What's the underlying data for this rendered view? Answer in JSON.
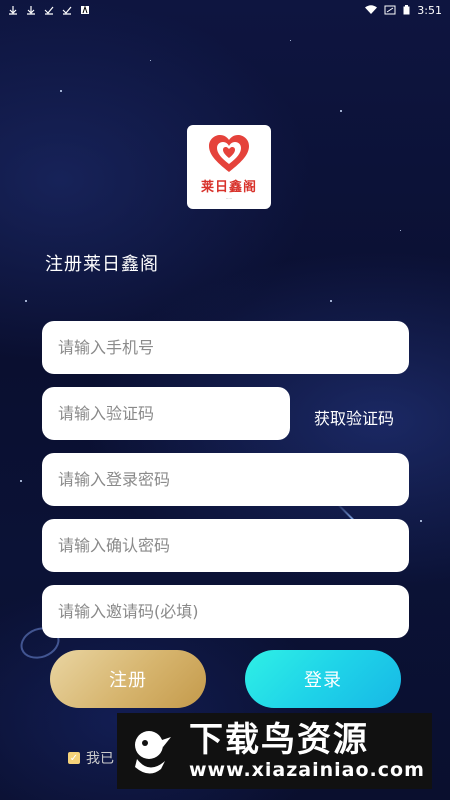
{
  "status_bar": {
    "time": "3:51"
  },
  "logo": {
    "text": "莱日鑫阁"
  },
  "page_title": "注册莱日鑫阁",
  "form": {
    "phone_placeholder": "请输入手机号",
    "code_placeholder": "请输入验证码",
    "get_code_label": "获取验证码",
    "password_placeholder": "请输入登录密码",
    "confirm_placeholder": "请输入确认密码",
    "invite_placeholder": "请输入邀请码(必填)"
  },
  "buttons": {
    "register_label": "注册",
    "login_label": "登录"
  },
  "agreement": {
    "text": "我已"
  },
  "watermark": {
    "title": "下载鸟资源",
    "url": "www.xiazainiao.com"
  },
  "colors": {
    "register_gradient": "#d6b46d",
    "login_gradient": "#1fd3e8",
    "background": "#0b1030"
  }
}
